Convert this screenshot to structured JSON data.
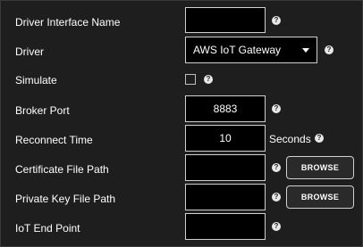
{
  "form": {
    "driver_interface_name": {
      "label": "Driver Interface Name",
      "value": ""
    },
    "driver": {
      "label": "Driver",
      "selected": "AWS IoT Gateway"
    },
    "simulate": {
      "label": "Simulate",
      "checked": false
    },
    "broker_port": {
      "label": "Broker Port",
      "value": "8883"
    },
    "reconnect_time": {
      "label": "Reconnect Time",
      "value": "10",
      "unit": "Seconds"
    },
    "certificate_file_path": {
      "label": "Certificate File Path",
      "value": "",
      "button": "BROWSE"
    },
    "private_key_file_path": {
      "label": "Private Key File Path",
      "value": "",
      "button": "BROWSE"
    },
    "iot_end_point": {
      "label": "IoT End Point",
      "value": ""
    }
  },
  "help_glyph": "?",
  "icons": {
    "help": "question-circle-icon",
    "dropdown": "chevron-down-icon"
  },
  "colors": {
    "background": "#1e1e1e",
    "input_background": "#000000",
    "input_border": "#cfcfcf",
    "text": "#ffffff"
  }
}
